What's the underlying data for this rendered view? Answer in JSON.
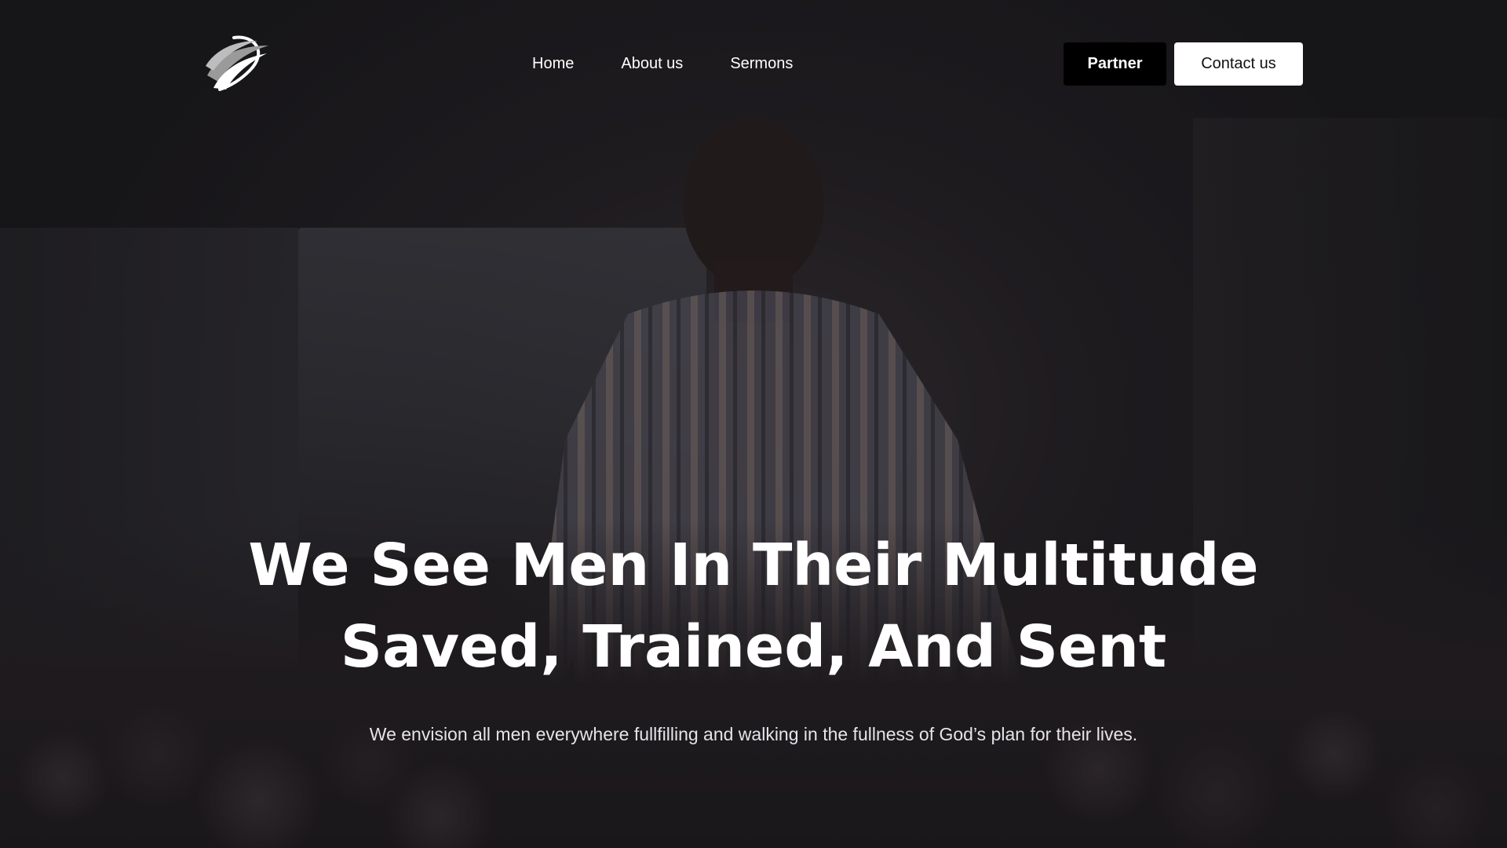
{
  "nav": {
    "logo_icon": "swoosh-globe-logo",
    "links": [
      {
        "label": "Home"
      },
      {
        "label": "About us"
      },
      {
        "label": "Sermons"
      }
    ],
    "partner_label": "Partner",
    "contact_label": "Contact us"
  },
  "hero": {
    "headline_line1": "We See Men In Their Multitude",
    "headline_line2": "Saved, Trained, And Sent",
    "subtext": "We envision all men everywhere fullfilling and walking in the fullness of God’s plan for their lives."
  },
  "colors": {
    "background": "#1c1a1e",
    "partner_button": "#000000",
    "contact_button": "#ffffff",
    "text": "#ffffff"
  }
}
